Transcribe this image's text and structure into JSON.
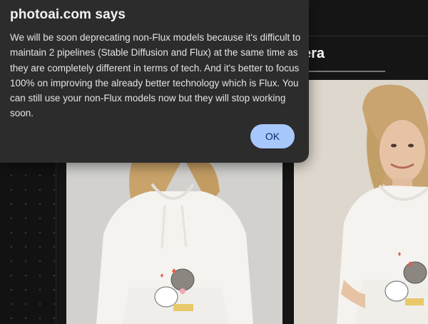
{
  "dialog": {
    "title": "photoai.com says",
    "message": "We will be soon deprecating non-Flux models because it's difficult to maintain 2 pipelines (Stable Diffusion and Flux) at the same time as they are completely different in terms of tech. And it's better to focus 100% on improving the already better technology which is Flux. You can still use your non-Flux models now but they will stop working soon.",
    "ok_label": "OK"
  },
  "background": {
    "tab_label": "era"
  },
  "colors": {
    "dialog_bg": "#2c2c2c",
    "ok_button_bg": "#a8c7fa",
    "ok_button_text": "#062e6f",
    "page_bg": "#151515"
  }
}
